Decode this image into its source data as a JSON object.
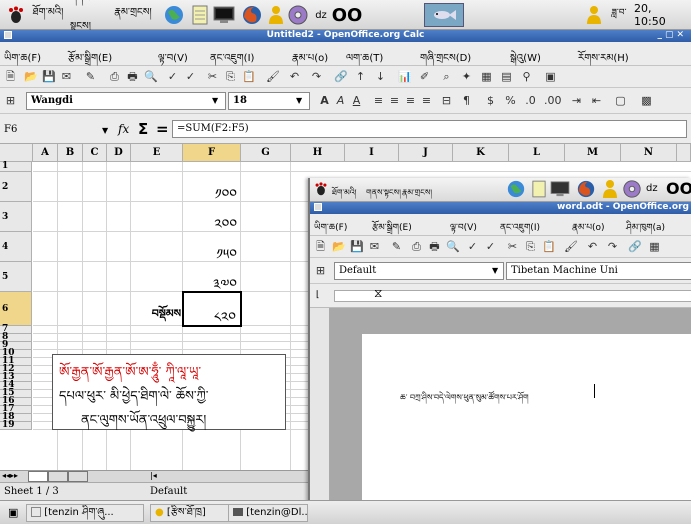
{
  "top_panel": {
    "menu1": "ཐོག་མའི།",
    "menu2": "གནས་སྟངས།",
    "menu3": "རྣམ་གྲངས།",
    "user": "dz",
    "clock": "20, 10:50",
    "clock_prefix": "ཟླ་བ་",
    "logo_text": "OO"
  },
  "calc": {
    "title": "Untitled2 - OpenOffice.org Calc",
    "menu": [
      "ཡིག་ཆ(F)",
      "རྩོམ་སྒྲིག(E)",
      "ལྟ་བ(V)",
      "ནང་འཇུག(I)",
      "རྣམ་པ(o)",
      "ལག་ཆ(T)",
      "གཞི་གྲངས(D)",
      "སྒེའུ(W)",
      "རོགས་རམ(H)"
    ],
    "font_name": "Wangdi",
    "font_size": "18",
    "cell_ref": "F6",
    "formula": "=SUM(F2:F5)",
    "columns": [
      "A",
      "B",
      "C",
      "D",
      "E",
      "F",
      "G",
      "H",
      "I",
      "J",
      "K",
      "L",
      "M",
      "N"
    ],
    "rows": [
      "1",
      "2",
      "3",
      "4",
      "5",
      "6",
      "7",
      "8",
      "9",
      "10",
      "11",
      "12",
      "13",
      "14",
      "15",
      "16",
      "17",
      "18",
      "19"
    ],
    "values": [
      "༡༠༠",
      "༢༠༠",
      "༡༥༠",
      "༣༧༠",
      "༨༢༠"
    ],
    "total_label": "བསྡོམས",
    "callout": {
      "line1": "ཨོ་རྒྱན་ཨོ་རྒྱན་ཨོ་ཨ་ཧཱུྃ་ ཀཱི་ལཱ་ཡཱ་",
      "line2": "དཔལ་ཕུར་ མི་ཕྱེད་ཐིག་ལེ་ ཆོས་ཀྱི་",
      "line3": "ནང་ལུགས་ཡོན་འཕྲུལ་བསྐྱུར།"
    },
    "sheet_label": "Sheet 1 / 3",
    "page_style": "Default"
  },
  "writer": {
    "title": "word.odt - OpenOffice.org",
    "menu": [
      "ཡིག་ཆ(F)",
      "རྩོམ་སྒྲིག(E)",
      "ལྟ་བ(V)",
      "ནང་འཇུག(I)",
      "རྣམ་པ(o)",
      "ཤིམ་ཁུག(a)"
    ],
    "style": "Default",
    "font": "Tibetan Machine Uni",
    "doc_text": "ཆ་ བཀྲ་ཤིས་བདེ་ལེགས་ཕུན་སུམ་ཚོགས་པར་ཤོག",
    "user": "dz"
  },
  "taskbar": {
    "item1": "[tenzin ཤིག་ཞུ...",
    "item2": "[རྩིས་ཐོ་ཁྲ]",
    "item3": "[tenzin@Dl..."
  }
}
